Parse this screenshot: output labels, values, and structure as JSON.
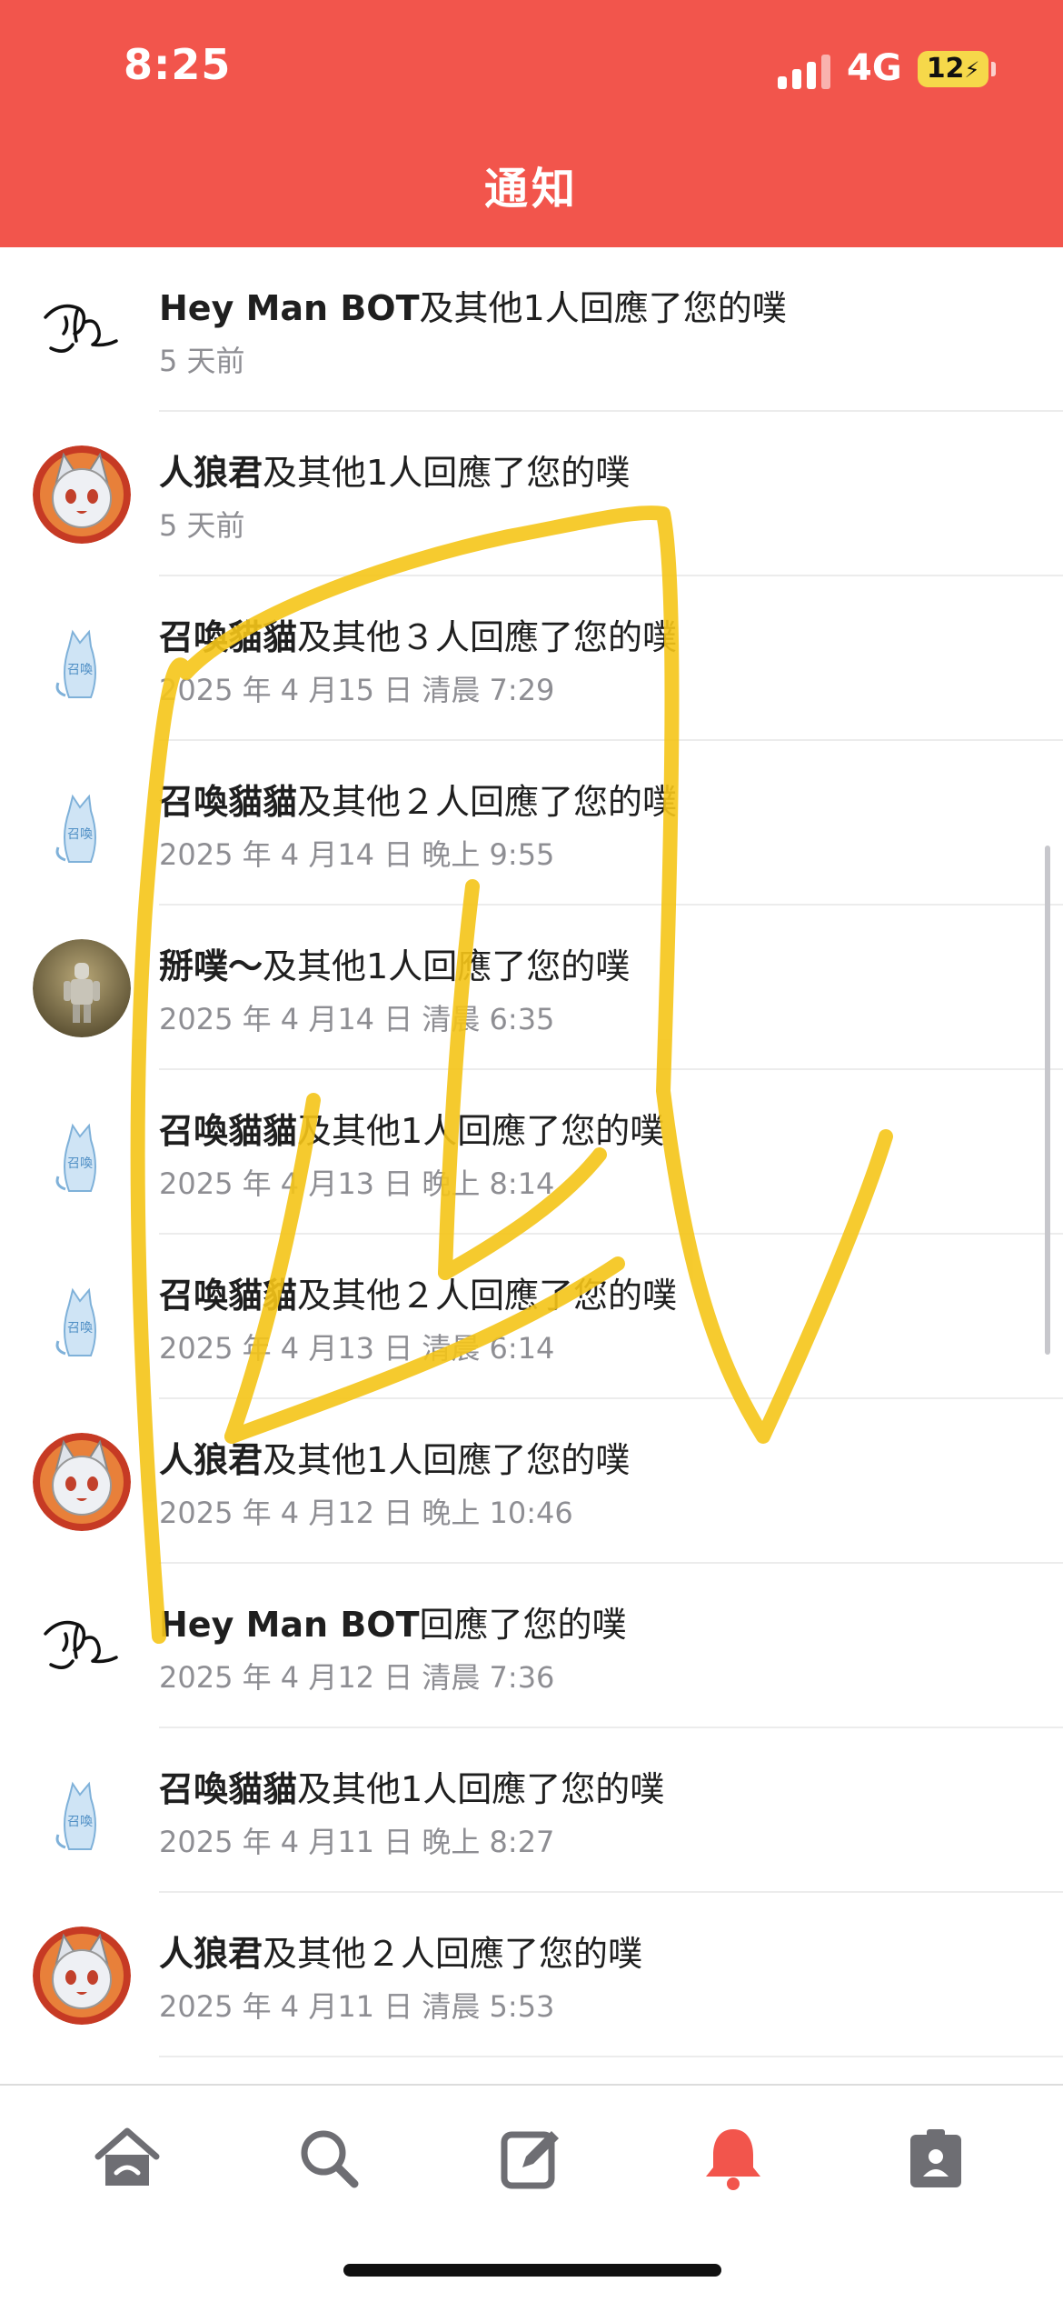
{
  "status_bar": {
    "time": "8:25",
    "network": "4G",
    "battery": "12"
  },
  "header": {
    "title": "通知"
  },
  "notifications": [
    {
      "avatar": "line-drawing-avatar",
      "name": "Hey Man BOT",
      "action": "及其他1人回應了您的噗",
      "time": "5 天前"
    },
    {
      "avatar": "werewolf-avatar",
      "name": "人狼君",
      "action": "及其他1人回應了您的噗",
      "time": "5 天前"
    },
    {
      "avatar": "cat-avatar",
      "name": "召喚貓貓",
      "action": "及其他３人回應了您的噗",
      "time": "2025 年 4 月15 日 清晨 7:29"
    },
    {
      "avatar": "cat-avatar",
      "name": "召喚貓貓",
      "action": "及其他２人回應了您的噗",
      "time": "2025 年 4 月14 日 晚上 9:55"
    },
    {
      "avatar": "knight-avatar",
      "name": "掰噗～",
      "action": "及其他1人回應了您的噗",
      "time": "2025 年 4 月14 日 清晨 6:35"
    },
    {
      "avatar": "cat-avatar",
      "name": "召喚貓貓",
      "action": "及其他1人回應了您的噗",
      "time": "2025 年 4 月13 日 晚上 8:14"
    },
    {
      "avatar": "cat-avatar",
      "name": "召喚貓貓",
      "action": "及其他２人回應了您的噗",
      "time": "2025 年 4 月13 日 清晨 6:14"
    },
    {
      "avatar": "werewolf-avatar",
      "name": "人狼君",
      "action": "及其他1人回應了您的噗",
      "time": "2025 年 4 月12 日 晚上 10:46"
    },
    {
      "avatar": "line-drawing-avatar",
      "name": "Hey Man BOT",
      "action": "回應了您的噗",
      "time": "2025 年 4 月12 日 清晨 7:36"
    },
    {
      "avatar": "cat-avatar",
      "name": "召喚貓貓",
      "action": "及其他1人回應了您的噗",
      "time": "2025 年 4 月11 日 晚上 8:27"
    },
    {
      "avatar": "werewolf-avatar",
      "name": "人狼君",
      "action": "及其他２人回應了您的噗",
      "time": "2025 年 4 月11 日 清晨 5:53"
    }
  ],
  "tabbar": [
    {
      "icon": "home-icon",
      "active": false
    },
    {
      "icon": "search-icon",
      "active": false
    },
    {
      "icon": "compose-icon",
      "active": false
    },
    {
      "icon": "bell-icon",
      "active": true
    },
    {
      "icon": "profile-card-icon",
      "active": false
    }
  ],
  "colors": {
    "brand": "#f2554c",
    "tab_inactive": "#6e6e73",
    "tab_active": "#f2554c",
    "highlight": "#f5c518"
  }
}
